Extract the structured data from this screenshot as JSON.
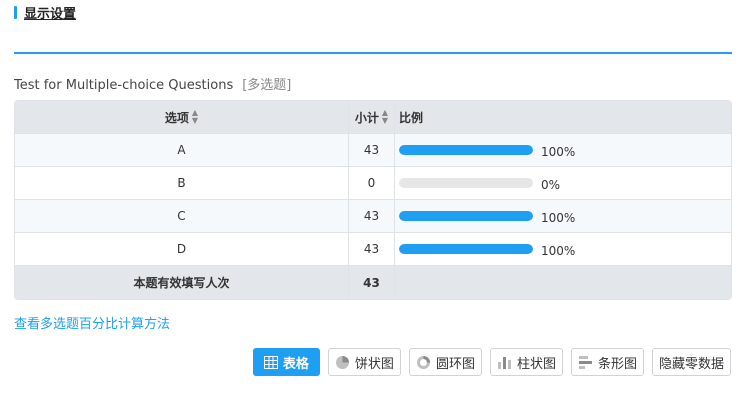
{
  "section": {
    "title": "显示设置"
  },
  "question": {
    "text": "Test for Multiple-choice Questions",
    "type": "[多选题]"
  },
  "table": {
    "headers": {
      "option": "选项",
      "subtotal": "小计",
      "ratio": "比例"
    },
    "rows": [
      {
        "option": "A",
        "count": "43",
        "percent": "100%",
        "fraction": 1.0
      },
      {
        "option": "B",
        "count": "0",
        "percent": "0%",
        "fraction": 0.0
      },
      {
        "option": "C",
        "count": "43",
        "percent": "100%",
        "fraction": 1.0
      },
      {
        "option": "D",
        "count": "43",
        "percent": "100%",
        "fraction": 1.0
      }
    ],
    "footer": {
      "label": "本题有效填写人次",
      "count": "43"
    }
  },
  "calc_link": "查看多选题百分比计算方法",
  "view_buttons": {
    "table": "表格",
    "pie": "饼状图",
    "ring": "圆环图",
    "column": "柱状图",
    "bar": "条形图",
    "hide_zero": "隐藏零数据"
  },
  "colors": {
    "accent": "#1e9ff2",
    "track": "#e6e6e6",
    "header_bg": "#e3e6ea"
  }
}
